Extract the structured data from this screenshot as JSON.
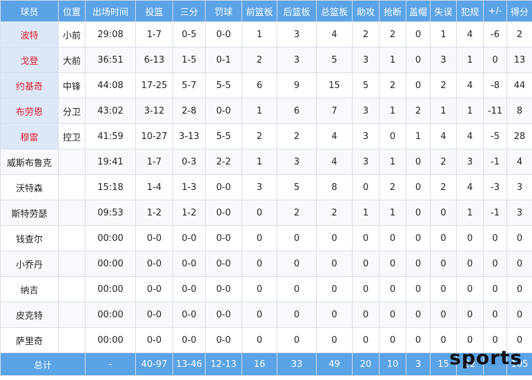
{
  "headers": [
    "球员",
    "位置",
    "出场时间",
    "投篮",
    "三分",
    "罚球",
    "前篮板",
    "后篮板",
    "总篮板",
    "助攻",
    "抢断",
    "盖帽",
    "失误",
    "犯规",
    "+/-",
    "得分"
  ],
  "players": [
    {
      "name": "波特",
      "pos": "小前",
      "min": "29:08",
      "fg": "1-7",
      "tp": "0-5",
      "ft": "0-0",
      "oreb": "1",
      "dreb": "3",
      "reb": "4",
      "ast": "2",
      "stl": "2",
      "blk": "0",
      "tov": "1",
      "pf": "4",
      "pm": "-6",
      "pts": "2",
      "starter": true
    },
    {
      "name": "戈登",
      "pos": "大前",
      "min": "36:51",
      "fg": "6-13",
      "tp": "1-5",
      "ft": "0-1",
      "oreb": "2",
      "dreb": "3",
      "reb": "5",
      "ast": "3",
      "stl": "1",
      "blk": "0",
      "tov": "3",
      "pf": "1",
      "pm": "0",
      "pts": "13",
      "starter": true
    },
    {
      "name": "约基奇",
      "pos": "中锋",
      "min": "44:08",
      "fg": "17-25",
      "tp": "5-7",
      "ft": "5-5",
      "oreb": "6",
      "dreb": "9",
      "reb": "15",
      "ast": "5",
      "stl": "2",
      "blk": "0",
      "tov": "2",
      "pf": "4",
      "pm": "-8",
      "pts": "44",
      "starter": true
    },
    {
      "name": "布劳恩",
      "pos": "分卫",
      "min": "43:02",
      "fg": "3-12",
      "tp": "2-8",
      "ft": "0-0",
      "oreb": "1",
      "dreb": "6",
      "reb": "7",
      "ast": "3",
      "stl": "1",
      "blk": "2",
      "tov": "1",
      "pf": "1",
      "pm": "-11",
      "pts": "8",
      "starter": true
    },
    {
      "name": "穆雷",
      "pos": "控卫",
      "min": "41:59",
      "fg": "10-27",
      "tp": "3-13",
      "ft": "5-5",
      "oreb": "2",
      "dreb": "2",
      "reb": "4",
      "ast": "3",
      "stl": "0",
      "blk": "1",
      "tov": "4",
      "pf": "4",
      "pm": "-5",
      "pts": "28",
      "starter": true
    },
    {
      "name": "威斯布鲁克",
      "pos": "",
      "min": "19:41",
      "fg": "1-7",
      "tp": "0-3",
      "ft": "2-2",
      "oreb": "1",
      "dreb": "3",
      "reb": "4",
      "ast": "3",
      "stl": "1",
      "blk": "0",
      "tov": "2",
      "pf": "3",
      "pm": "-1",
      "pts": "4",
      "starter": false
    },
    {
      "name": "沃特森",
      "pos": "",
      "min": "15:18",
      "fg": "1-4",
      "tp": "1-3",
      "ft": "0-0",
      "oreb": "3",
      "dreb": "5",
      "reb": "8",
      "ast": "0",
      "stl": "2",
      "blk": "0",
      "tov": "2",
      "pf": "4",
      "pm": "-3",
      "pts": "3",
      "starter": false
    },
    {
      "name": "斯特劳瑟",
      "pos": "",
      "min": "09:53",
      "fg": "1-2",
      "tp": "1-2",
      "ft": "0-0",
      "oreb": "0",
      "dreb": "2",
      "reb": "2",
      "ast": "1",
      "stl": "1",
      "blk": "0",
      "tov": "0",
      "pf": "1",
      "pm": "-1",
      "pts": "3",
      "starter": false
    },
    {
      "name": "钱查尔",
      "pos": "",
      "min": "00:00",
      "fg": "0-0",
      "tp": "0-0",
      "ft": "0-0",
      "oreb": "0",
      "dreb": "0",
      "reb": "0",
      "ast": "0",
      "stl": "0",
      "blk": "0",
      "tov": "0",
      "pf": "0",
      "pm": "0",
      "pts": "0",
      "starter": false
    },
    {
      "name": "小乔丹",
      "pos": "",
      "min": "00:00",
      "fg": "0-0",
      "tp": "0-0",
      "ft": "0-0",
      "oreb": "0",
      "dreb": "0",
      "reb": "0",
      "ast": "0",
      "stl": "0",
      "blk": "0",
      "tov": "0",
      "pf": "0",
      "pm": "0",
      "pts": "0",
      "starter": false
    },
    {
      "name": "纳吉",
      "pos": "",
      "min": "00:00",
      "fg": "0-0",
      "tp": "0-0",
      "ft": "0-0",
      "oreb": "0",
      "dreb": "0",
      "reb": "0",
      "ast": "0",
      "stl": "0",
      "blk": "0",
      "tov": "0",
      "pf": "0",
      "pm": "0",
      "pts": "0",
      "starter": false
    },
    {
      "name": "皮克特",
      "pos": "",
      "min": "00:00",
      "fg": "0-0",
      "tp": "0-0",
      "ft": "0-0",
      "oreb": "0",
      "dreb": "0",
      "reb": "0",
      "ast": "0",
      "stl": "0",
      "blk": "0",
      "tov": "0",
      "pf": "0",
      "pm": "0",
      "pts": "0",
      "starter": false
    },
    {
      "name": "萨里奇",
      "pos": "",
      "min": "00:00",
      "fg": "0-0",
      "tp": "0-0",
      "ft": "0-0",
      "oreb": "0",
      "dreb": "0",
      "reb": "0",
      "ast": "0",
      "stl": "0",
      "blk": "0",
      "tov": "0",
      "pf": "0",
      "pm": "0",
      "pts": "0",
      "starter": false
    }
  ],
  "totals": [
    "总计",
    "",
    "-",
    "40-97",
    "13-46",
    "12-13",
    "16",
    "33",
    "49",
    "20",
    "10",
    "3",
    "15",
    "22",
    "",
    "105"
  ],
  "watermark": "sports"
}
